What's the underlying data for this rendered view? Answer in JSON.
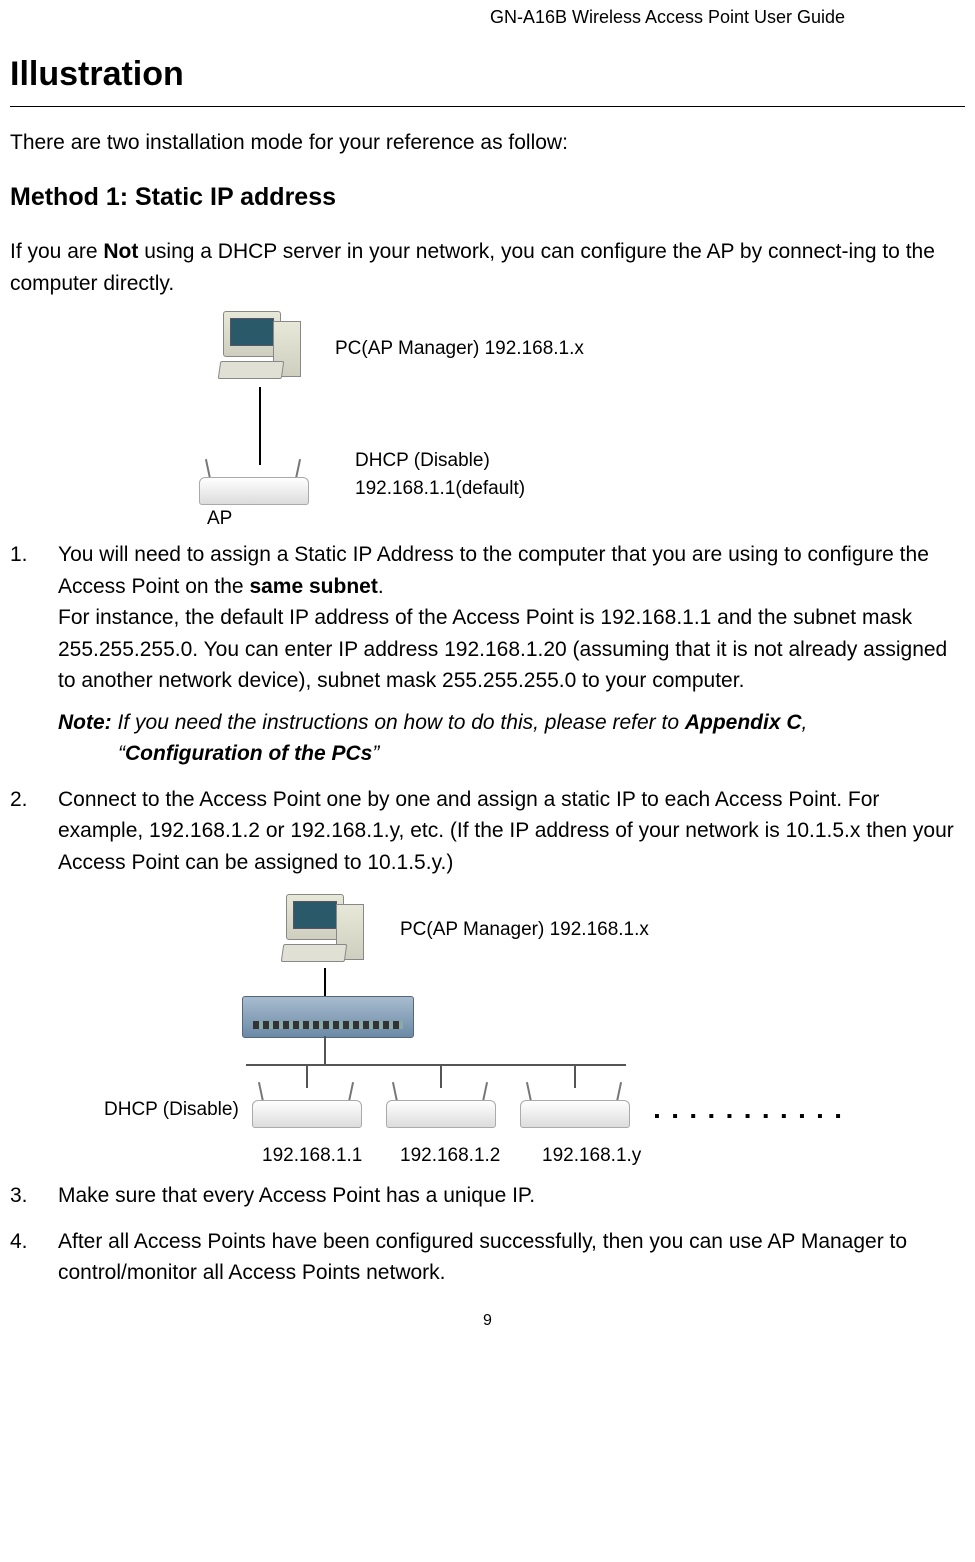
{
  "header": {
    "guide": "GN-A16B Wireless Access Point User Guide"
  },
  "title": "Illustration",
  "intro": "There are two installation mode for your reference as follow:",
  "method1": {
    "heading": "Method 1:  Static IP address",
    "para_prefix": "If you are ",
    "para_bold": "Not",
    "para_suffix": " using a DHCP server in your network, you can configure the AP by connect-ing to the computer directly."
  },
  "diagram1": {
    "pc_label": "PC(AP Manager) 192.168.1.x",
    "ap_label": "AP",
    "dhcp": "DHCP (Disable)",
    "ip": "192.168.1.1(default)"
  },
  "step1": {
    "num": "1.",
    "line1_prefix": "You will need to assign a Static IP Address to the computer that you are using to configure the Access Point on the ",
    "line1_bold": "same subnet",
    "line1_suffix": ".",
    "line2": "For instance, the default IP address of the Access Point is 192.168.1.1 and the subnet mask 255.255.255.0. You can enter IP address 192.168.1.20 (assuming that it is not already assigned to another network device), subnet mask 255.255.255.0 to your computer.",
    "note_label": "Note:",
    "note_text1": "If you need the instructions on how to do this, please refer to ",
    "note_bold1": "Appendix C",
    "note_comma": ",",
    "note_quote_open": "“",
    "note_bold2": "Configuration of the PCs",
    "note_quote_close": "”"
  },
  "step2": {
    "num": "2.",
    "text": "Connect to the Access Point one by one and assign a static IP to each Access Point. For example, 192.168.1.2 or 192.168.1.y, etc. (If the IP address of your network is 10.1.5.x then your Access Point can be assigned to 10.1.5.y.)"
  },
  "diagram2": {
    "pc_label": "PC(AP Manager) 192.168.1.x",
    "dhcp": "DHCP (Disable)",
    "ip1": "192.168.1.1",
    "ip2": "192.168.1.2",
    "ip3": "192.168.1.y",
    "dots": "▪ ▪ ▪ ▪ ▪ ▪ ▪ ▪ ▪ ▪ ▪"
  },
  "step3": {
    "num": "3.",
    "text": "Make sure that every Access Point has a unique IP."
  },
  "step4": {
    "num": "4.",
    "text": "After all Access Points have been configured successfully, then you can use AP Manager to control/monitor all Access Points network."
  },
  "page_number": "9"
}
